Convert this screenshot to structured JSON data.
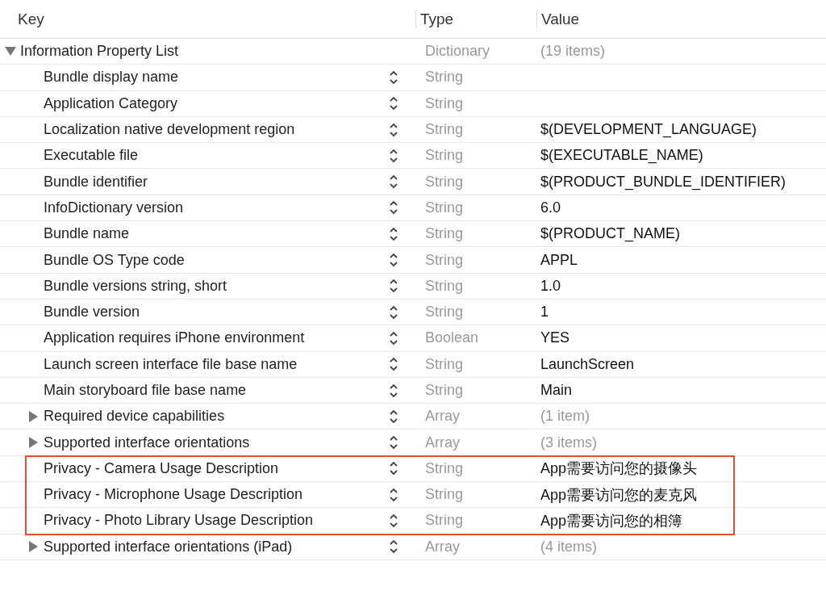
{
  "columns": [
    "Key",
    "Type",
    "Value"
  ],
  "root": {
    "key": "Information Property List",
    "type": "Dictionary",
    "value": "(19 items)",
    "expanded": true,
    "children": [
      {
        "key": "Bundle display name",
        "type": "String",
        "highlighted": false
      },
      {
        "key": "Application Category",
        "type": "String",
        "highlighted": false
      },
      {
        "key": "Localization native development region",
        "type": "String",
        "value": "$(DEVELOPMENT_LANGUAGE)",
        "highlighted": false
      },
      {
        "key": "Executable file",
        "type": "String",
        "value": "$(EXECUTABLE_NAME)",
        "highlighted": false
      },
      {
        "key": "Bundle identifier",
        "type": "String",
        "value": "$(PRODUCT_BUNDLE_IDENTIFIER)",
        "highlighted": false
      },
      {
        "key": "InfoDictionary version",
        "type": "String",
        "value": "6.0",
        "highlighted": false
      },
      {
        "key": "Bundle name",
        "type": "String",
        "value": "$(PRODUCT_NAME)",
        "highlighted": false
      },
      {
        "key": "Bundle OS Type code",
        "type": "String",
        "value": "APPL",
        "highlighted": false
      },
      {
        "key": "Bundle versions string, short",
        "type": "String",
        "value": "1.0",
        "highlighted": false
      },
      {
        "key": "Bundle version",
        "type": "String",
        "value": "1",
        "highlighted": false
      },
      {
        "key": "Application requires iPhone environment",
        "type": "Boolean",
        "value": "YES",
        "highlighted": false
      },
      {
        "key": "Launch screen interface file base name",
        "type": "String",
        "value": "LaunchScreen",
        "highlighted": false
      },
      {
        "key": "Main storyboard file base name",
        "type": "String",
        "value": "Main",
        "highlighted": false
      },
      {
        "key": "Required device capabilities",
        "type": "Array",
        "value": "(1 item)",
        "expanded": false,
        "highlighted": false
      },
      {
        "key": "Supported interface orientations",
        "type": "Array",
        "value": "(3 items)",
        "expanded": false,
        "highlighted": false
      },
      {
        "key": "Privacy - Camera Usage Description",
        "type": "String",
        "value": "App需要访问您的摄像头",
        "highlighted": true
      },
      {
        "key": "Privacy - Microphone Usage Description",
        "type": "String",
        "value": "App需要访问您的麦克风",
        "highlighted": true
      },
      {
        "key": "Privacy - Photo Library Usage Description",
        "type": "String",
        "value": "App需要访问您的相簿",
        "highlighted": true
      },
      {
        "key": "Supported interface orientations (iPad)",
        "type": "Array",
        "value": "(4 items)",
        "expanded": false,
        "highlighted": false
      }
    ]
  }
}
